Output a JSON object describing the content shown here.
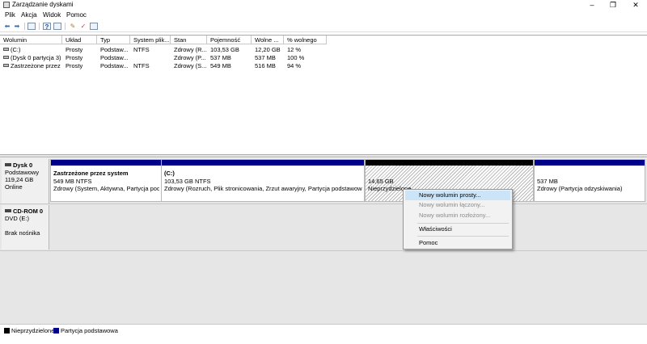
{
  "window": {
    "title": "Zarządzanie dyskami",
    "buttons": {
      "minimize": "–",
      "maximize": "❐",
      "close": "✕"
    }
  },
  "menu": [
    "Plik",
    "Akcja",
    "Widok",
    "Pomoc"
  ],
  "toolbar": {
    "icons": [
      "back-arrow-icon",
      "forward-arrow-icon",
      "console-icon",
      "help-icon",
      "properties-icon",
      "connect-icon",
      "check-icon",
      "list-icon"
    ],
    "glyphs": [
      "⬅",
      "➡",
      "▤",
      "?",
      "▦",
      "✎",
      "✓",
      "▦"
    ]
  },
  "volumes": {
    "columns": [
      "Wolumin",
      "Układ",
      "Typ",
      "System plik...",
      "Stan",
      "Pojemność",
      "Wolne ...",
      "% wolnego"
    ],
    "rows": [
      [
        "(C:)",
        "Prosty",
        "Podstaw...",
        "NTFS",
        "Zdrowy (R...",
        "103,53 GB",
        "12,20 GB",
        "12 %"
      ],
      [
        "(Dysk 0 partycja 3)",
        "Prosty",
        "Podstaw...",
        "",
        "Zdrowy (P...",
        "537 MB",
        "537 MB",
        "100 %"
      ],
      [
        "Zastrzeżone przez ...",
        "Prosty",
        "Podstaw...",
        "NTFS",
        "Zdrowy (S...",
        "549 MB",
        "516 MB",
        "94 %"
      ]
    ]
  },
  "disks": [
    {
      "name": "Dysk 0",
      "lines": [
        "Podstawowy",
        "119,24 GB",
        "Online"
      ],
      "partitions": [
        {
          "title": "Zastrzeżone przez system",
          "size": "549 MB NTFS",
          "status": "Zdrowy (System, Aktywna, Partycja podst"
        },
        {
          "title": "(C:)",
          "size": "103,53 GB NTFS",
          "status": "Zdrowy (Rozruch, Plik stronicowania, Zrzut awaryjny, Partycja podstawowa)"
        },
        {
          "title": "",
          "size": "14,65 GB",
          "status": "Nieprzydzielone"
        },
        {
          "title": "",
          "size": "537 MB",
          "status": "Zdrowy (Partycja odzyskiwania)"
        }
      ]
    },
    {
      "name": "CD-ROM 0",
      "lines": [
        "DVD (E:)",
        "",
        "Brak nośnika"
      ]
    }
  ],
  "context_menu": {
    "items": [
      "Nowy wolumin prosty...",
      "Nowy wolumin łączony...",
      "Nowy wolumin rozłożony...",
      "Właściwości",
      "Pomoc"
    ]
  },
  "legend": {
    "items": [
      "Nieprzydzielone",
      "Partycja podstawowa"
    ],
    "colors": [
      "#000000",
      "#00008b"
    ]
  }
}
